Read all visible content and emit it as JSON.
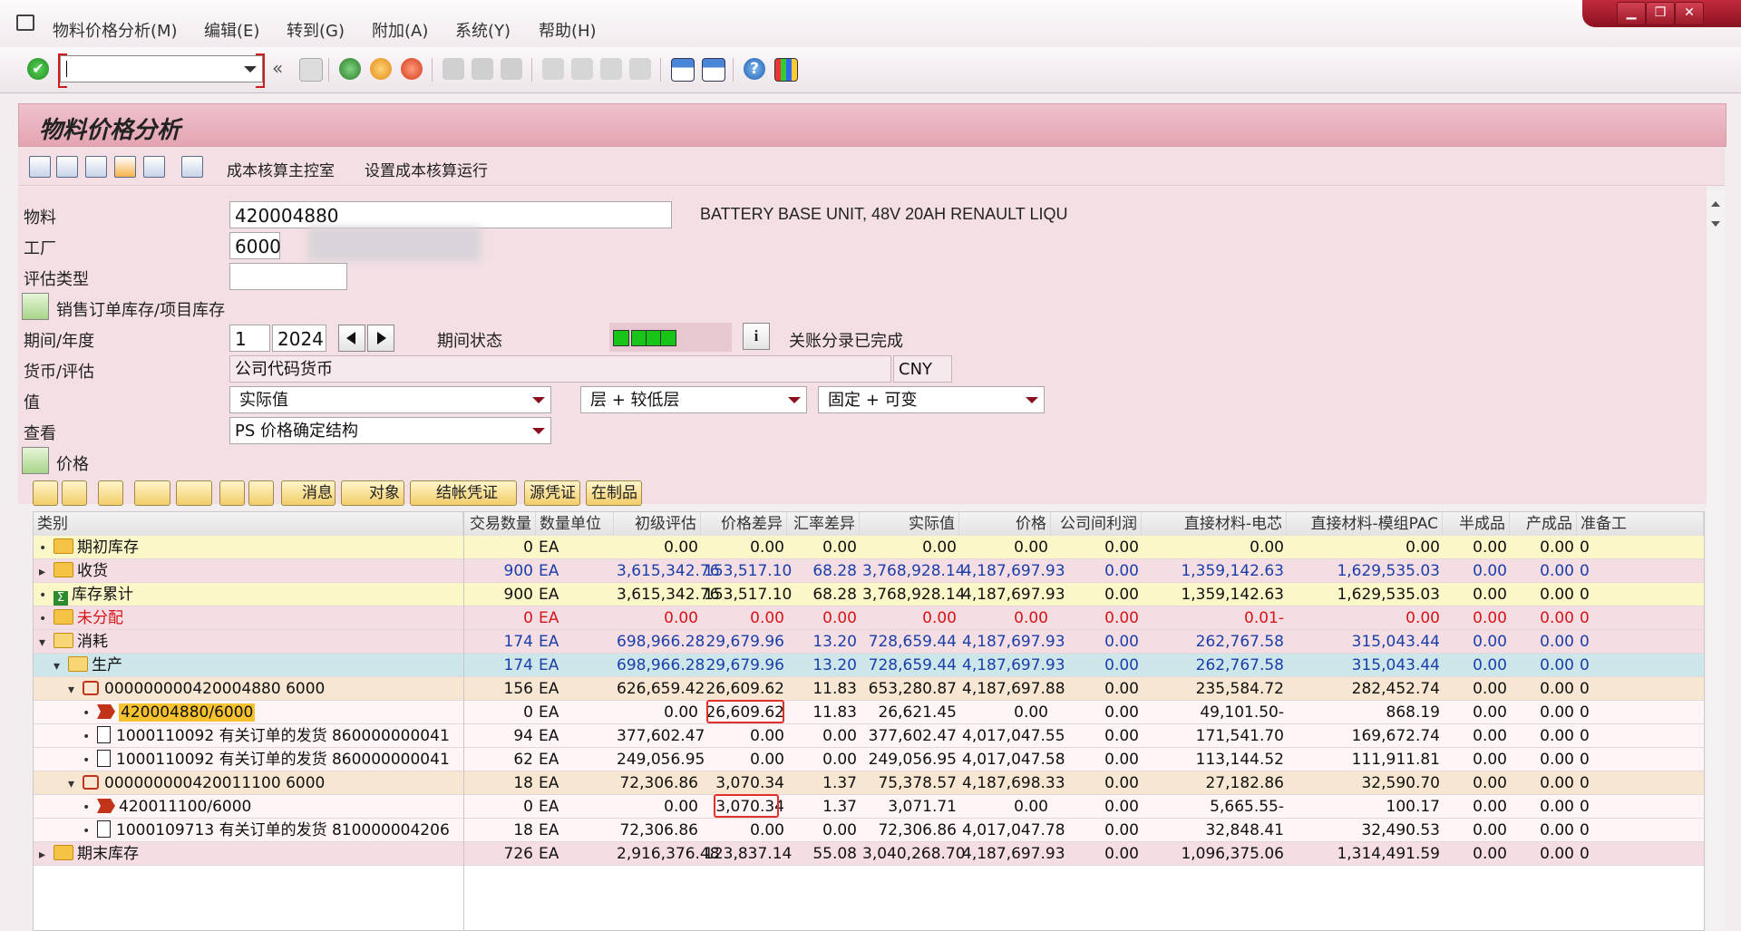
{
  "menu": {
    "items": [
      "物料价格分析(M)",
      "编辑(E)",
      "转到(G)",
      "附加(A)",
      "系统(Y)",
      "帮助(H)"
    ]
  },
  "window_controls": [
    "minimize",
    "restore",
    "close"
  ],
  "toolbar": {
    "command_field": {
      "value": "",
      "placeholder": ""
    },
    "icons": [
      "enter-icon",
      "back-icon",
      "exit-icon",
      "cancel-icon",
      "print-icon",
      "find-icon",
      "find-next-icon",
      "first-page-icon",
      "prev-page-icon",
      "next-page-icon",
      "last-page-icon",
      "new-session-icon",
      "shortcut-icon",
      "help-icon",
      "layout-icon"
    ]
  },
  "title": "物料价格分析",
  "app_toolbar": {
    "icons": [
      "refresh-icon",
      "list-icon",
      "hierarchy-icon",
      "display-icon",
      "columns-icon",
      "analysis-icon"
    ],
    "links": [
      "成本核算主控室",
      "设置成本核算运行"
    ]
  },
  "form": {
    "material_label": "物料",
    "material_value": "420004880",
    "material_desc": "BATTERY BASE UNIT, 48V 20AH RENAULT LIQU",
    "plant_label": "工厂",
    "plant_value": "6000",
    "valuation_type_label": "评估类型",
    "valuation_type_value": "",
    "sales_stock_label": "销售订单库存/项目库存",
    "period_label": "期间/年度",
    "period_value": "1",
    "year_value": "2024",
    "period_status_label": "期间状态",
    "period_status_text": "关账分录已完成",
    "currency_label": "货币/评估",
    "currency_value": "公司代码货币",
    "currency_code": "CNY",
    "value_label": "值",
    "value_select": "实际值",
    "layer_select": "层 + 较低层",
    "fixed_select": "固定 + 可变",
    "view_label": "查看",
    "view_select": "PS 价格确定结构",
    "price_section_label": "价格"
  },
  "grid_toolbar": {
    "buttons": [
      "消息",
      "对象",
      "结帐凭证",
      "源凭证",
      "在制品"
    ]
  },
  "grid": {
    "columns": [
      "类别",
      "交易数量",
      "数量单位",
      "初级评估",
      "价格差异",
      "汇率差异",
      "实际值",
      "价格",
      "公司间利润",
      "直接材料-电芯",
      "直接材料-模组PAC",
      "半成品",
      "产成品",
      "准备工"
    ],
    "rows": [
      {
        "label": "期初库存",
        "type": "folder",
        "level": 0,
        "expander": "•",
        "qty": "0",
        "unit": "EA",
        "primary": "0.00",
        "price_var": "0.00",
        "fx_var": "0.00",
        "actual": "0.00",
        "price": "0.00",
        "ic_profit": "0.00",
        "dm_cell": "0.00",
        "dm_pac": "0.00",
        "semi": "0.00",
        "fg": "0.00",
        "prep": "0",
        "bg": "#fbf7c8",
        "color": "#111"
      },
      {
        "label": "收货",
        "type": "folder",
        "level": 0,
        "expander": "▸",
        "qty": "900",
        "unit": "EA",
        "primary": "3,615,342.76",
        "price_var": "153,517.10",
        "fx_var": "68.28",
        "actual": "3,768,928.14",
        "price": "4,187,697.93",
        "ic_profit": "0.00",
        "dm_cell": "1,359,142.63",
        "dm_pac": "1,629,535.03",
        "semi": "0.00",
        "fg": "0.00",
        "prep": "0",
        "bg": "#f4dde3",
        "color": "#1a3fa8"
      },
      {
        "label": "库存累计",
        "type": "sum",
        "level": 0,
        "expander": "•",
        "qty": "900",
        "unit": "EA",
        "primary": "3,615,342.76",
        "price_var": "153,517.10",
        "fx_var": "68.28",
        "actual": "3,768,928.14",
        "price": "4,187,697.93",
        "ic_profit": "0.00",
        "dm_cell": "1,359,142.63",
        "dm_pac": "1,629,535.03",
        "semi": "0.00",
        "fg": "0.00",
        "prep": "0",
        "bg": "#fbf7c8",
        "color": "#111"
      },
      {
        "label": "未分配",
        "type": "folder",
        "level": 0,
        "expander": "•",
        "qty": "0",
        "unit": "EA",
        "primary": "0.00",
        "price_var": "0.00",
        "fx_var": "0.00",
        "actual": "0.00",
        "price": "0.00",
        "ic_profit": "0.00",
        "dm_cell": "0.01-",
        "dm_pac": "0.00",
        "semi": "0.00",
        "fg": "0.00",
        "prep": "0",
        "bg": "#f4dde3",
        "color": "#d4161a"
      },
      {
        "label": "消耗",
        "type": "folder-open",
        "level": 0,
        "expander": "▾",
        "qty": "174",
        "unit": "EA",
        "primary": "698,966.28",
        "price_var": "29,679.96",
        "fx_var": "13.20",
        "actual": "728,659.44",
        "price": "4,187,697.93",
        "ic_profit": "0.00",
        "dm_cell": "262,767.58",
        "dm_pac": "315,043.44",
        "semi": "0.00",
        "fg": "0.00",
        "prep": "0",
        "bg": "#f4dde3",
        "color": "#1a3fa8"
      },
      {
        "label": "生产",
        "type": "folder-open",
        "level": 1,
        "expander": "▾",
        "qty": "174",
        "unit": "EA",
        "primary": "698,966.28",
        "price_var": "29,679.96",
        "fx_var": "13.20",
        "actual": "728,659.44",
        "price": "4,187,697.93",
        "ic_profit": "0.00",
        "dm_cell": "262,767.58",
        "dm_pac": "315,043.44",
        "semi": "0.00",
        "fg": "0.00",
        "prep": "0",
        "bg": "#cde6ea",
        "color": "#1a3fa8"
      },
      {
        "label": "000000000420004880 6000",
        "type": "order",
        "level": 2,
        "expander": "▾",
        "qty": "156",
        "unit": "EA",
        "primary": "626,659.42",
        "price_var": "26,609.62",
        "fx_var": "11.83",
        "actual": "653,280.87",
        "price": "4,187,697.88",
        "ic_profit": "0.00",
        "dm_cell": "235,584.72",
        "dm_pac": "282,452.74",
        "semi": "0.00",
        "fg": "0.00",
        "prep": "0",
        "bg": "#f7e7d2",
        "color": "#111"
      },
      {
        "label": "420004880/6000",
        "type": "material",
        "level": 3,
        "expander": "•",
        "highlight": true,
        "qty": "0",
        "unit": "EA",
        "primary": "0.00",
        "price_var": "26,609.62",
        "fx_var": "11.83",
        "actual": "26,621.45",
        "price": "0.00",
        "ic_profit": "0.00",
        "dm_cell": "49,101.50-",
        "dm_pac": "868.19",
        "semi": "0.00",
        "fg": "0.00",
        "prep": "0",
        "bg": "#fff5f6",
        "color": "#111"
      },
      {
        "label": "1000110092 有关订单的发货 860000000041",
        "type": "doc",
        "level": 3,
        "expander": "•",
        "qty": "94",
        "unit": "EA",
        "primary": "377,602.47",
        "price_var": "0.00",
        "fx_var": "0.00",
        "actual": "377,602.47",
        "price": "4,017,047.55",
        "ic_profit": "0.00",
        "dm_cell": "171,541.70",
        "dm_pac": "169,672.74",
        "semi": "0.00",
        "fg": "0.00",
        "prep": "0",
        "bg": "#fff5f6",
        "color": "#111"
      },
      {
        "label": "1000110092 有关订单的发货 860000000041",
        "type": "doc",
        "level": 3,
        "expander": "•",
        "qty": "62",
        "unit": "EA",
        "primary": "249,056.95",
        "price_var": "0.00",
        "fx_var": "0.00",
        "actual": "249,056.95",
        "price": "4,017,047.58",
        "ic_profit": "0.00",
        "dm_cell": "113,144.52",
        "dm_pac": "111,911.81",
        "semi": "0.00",
        "fg": "0.00",
        "prep": "0",
        "bg": "#fff5f6",
        "color": "#111"
      },
      {
        "label": "000000000420011100 6000",
        "type": "order",
        "level": 2,
        "expander": "▾",
        "qty": "18",
        "unit": "EA",
        "primary": "72,306.86",
        "price_var": "3,070.34",
        "fx_var": "1.37",
        "actual": "75,378.57",
        "price": "4,187,698.33",
        "ic_profit": "0.00",
        "dm_cell": "27,182.86",
        "dm_pac": "32,590.70",
        "semi": "0.00",
        "fg": "0.00",
        "prep": "0",
        "bg": "#f7e7d2",
        "color": "#111"
      },
      {
        "label": "420011100/6000",
        "type": "material",
        "level": 3,
        "expander": "•",
        "qty": "0",
        "unit": "EA",
        "primary": "0.00",
        "price_var": "3,070.34",
        "fx_var": "1.37",
        "actual": "3,071.71",
        "price": "0.00",
        "ic_profit": "0.00",
        "dm_cell": "5,665.55-",
        "dm_pac": "100.17",
        "semi": "0.00",
        "fg": "0.00",
        "prep": "0",
        "bg": "#fff5f6",
        "color": "#111"
      },
      {
        "label": "1000109713 有关订单的发货 810000004206",
        "type": "doc",
        "level": 3,
        "expander": "•",
        "qty": "18",
        "unit": "EA",
        "primary": "72,306.86",
        "price_var": "0.00",
        "fx_var": "0.00",
        "actual": "72,306.86",
        "price": "4,017,047.78",
        "ic_profit": "0.00",
        "dm_cell": "32,848.41",
        "dm_pac": "32,490.53",
        "semi": "0.00",
        "fg": "0.00",
        "prep": "0",
        "bg": "#fff5f6",
        "color": "#111"
      },
      {
        "label": "期末库存",
        "type": "folder",
        "level": 0,
        "expander": "▸",
        "qty": "726",
        "unit": "EA",
        "primary": "2,916,376.48",
        "price_var": "123,837.14",
        "fx_var": "55.08",
        "actual": "3,040,268.70",
        "price": "4,187,697.93",
        "ic_profit": "0.00",
        "dm_cell": "1,096,375.06",
        "dm_pac": "1,314,491.59",
        "semi": "0.00",
        "fg": "0.00",
        "prep": "0",
        "bg": "#f4dde3",
        "color": "#111"
      }
    ]
  },
  "colors": {
    "accent": "#e4a4b2",
    "status_green": "#18c418",
    "highlight_box": "#e0302a"
  }
}
